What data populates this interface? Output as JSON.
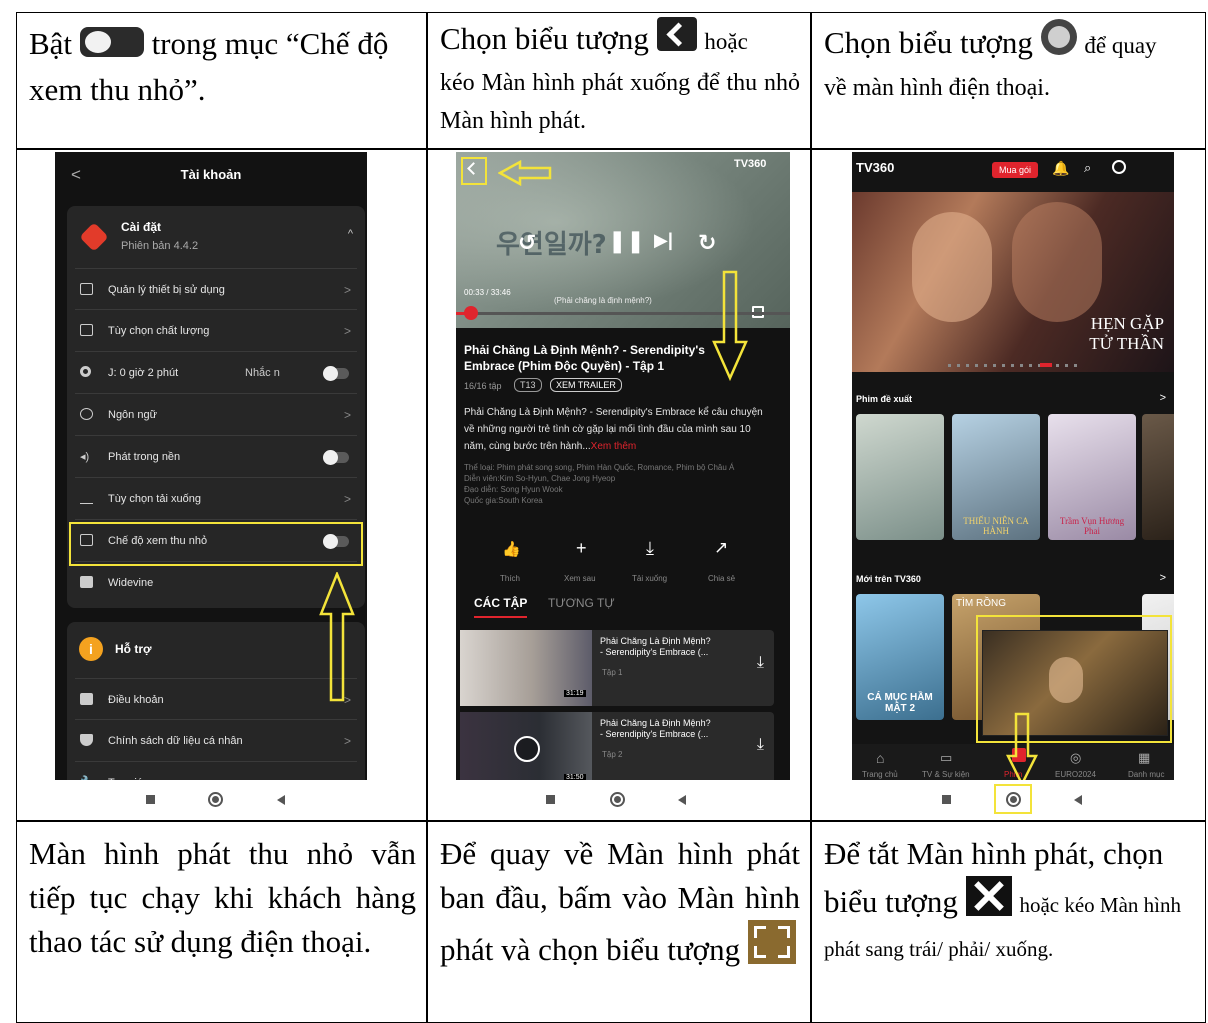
{
  "row1": {
    "col1": {
      "before": "Bật",
      "after": "trong mục “Chế độ xem thu nhỏ”.",
      "icon": "toggle-icon"
    },
    "col2": {
      "before": "Chọn biểu tượng",
      "mid": "hoặc",
      "after": "kéo Màn hình phát xuống để thu nhỏ Màn hình phát.",
      "icon": "back-chevron-icon"
    },
    "col3": {
      "before": "Chọn biểu tượng",
      "mid": "để quay",
      "after": "về màn hình điện thoại.",
      "icon": "home-circle-icon"
    }
  },
  "row3": {
    "col1": "Màn hình phát thu nhỏ vẫn tiếp tục chạy khi khách hàng thao tác sử dụng điện thoại.",
    "col2": {
      "text": "Để quay về Màn hình phát ban đầu, bấm vào Màn hình phát và chọn biểu tượng",
      "icon": "fullscreen-icon"
    },
    "col3": {
      "before": "Để tắt Màn hình phát, chọn biểu tượng",
      "after": "hoặc kéo Màn hình phát sang trái/ phải/ xuống.",
      "icon": "close-x-icon"
    }
  },
  "phone1": {
    "title": "Tài khoản",
    "back": "<",
    "settings_title": "Cài đặt",
    "version": "Phiên bản 4.4.2",
    "items": [
      {
        "label": "Quản lý thiết bị sử dụng",
        "type": "chevron"
      },
      {
        "label": "Tùy chọn chất lượng",
        "type": "chevron"
      },
      {
        "label": "J: 0 giờ 2 phút",
        "extra": "Nhắc n",
        "type": "toggle"
      },
      {
        "label": "Ngôn ngữ",
        "type": "chevron"
      },
      {
        "label": "Phát trong nền",
        "type": "toggle"
      },
      {
        "label": "Tùy chọn tải xuống",
        "type": "chevron"
      },
      {
        "label": "Chế độ xem thu nhỏ",
        "type": "toggle"
      },
      {
        "label": "Widevine",
        "type": "none"
      }
    ],
    "support_title": "Hỗ trợ",
    "support_items": [
      "Điều khoản",
      "Chính sách dữ liệu cá nhân",
      "Trợ giúp"
    ],
    "chev": ">",
    "up": "^"
  },
  "phone2": {
    "logo": "TV360",
    "time": "00:33 / 33:46",
    "subtitle": "(Phải chăng là định mệnh?)",
    "title": "Phải Chăng Là Định Mệnh? - Serendipity's Embrace (Phim Độc Quyền) - Tập 1",
    "episodes_count": "16/16 tập",
    "rating": "T13",
    "trailer": "XEM TRAILER",
    "description": "Phải Chăng Là Định Mệnh? - Serendipity's Embrace kể câu chuyện về những người trẻ tình cờ gặp lại mối tình đầu của mình sau 10 năm, cùng bước trên hành...",
    "see_more": "Xem thêm",
    "meta": [
      "Thể loại: Phim phát song song, Phim Hàn Quốc, Romance, Phim bộ Châu Á",
      "Diễn viên:Kim So-Hyun, Chae Jong Hyeop",
      "Đạo diễn: Song Hyun Wook",
      "Quốc gia:South Korea"
    ],
    "actions": [
      "Thích",
      "Xem sau",
      "Tải xuống",
      "Chia sẻ"
    ],
    "action_icons": [
      "👍",
      "+",
      "⤓",
      "↗"
    ],
    "tabs": [
      "CÁC TẬP",
      "TƯƠNG TỰ"
    ],
    "episodes": [
      {
        "title": "Phải Chăng Là Định Mệnh?",
        "sub": "- Serendipity's Embrace (...",
        "ep": "Tập 1",
        "dur": "31:19"
      },
      {
        "title": "Phải Chăng Là Định Mệnh?",
        "sub": "- Serendipity's Embrace (...",
        "ep": "Tập 2",
        "dur": "31:50"
      }
    ]
  },
  "phone3": {
    "logo": "TV360",
    "buy": "Mua gói",
    "hero_title1": "HẸN GẶP",
    "hero_title2": "TỬ THẦN",
    "section1": "Phim đề xuất",
    "section2": "Mới trên TV360",
    "poster_texts": [
      "THIẾU NIÊN CA HÀNH",
      "Trầm Vụn Hương Phai"
    ],
    "poster2_texts": [
      "CÁ MỤC HẦM MẬT 2",
      "TÌM RỒNG"
    ],
    "tabs": [
      "Trang chủ",
      "TV & Sự kiện",
      "Phim",
      "EURO2024",
      "Danh mục"
    ],
    "chev": ">"
  }
}
